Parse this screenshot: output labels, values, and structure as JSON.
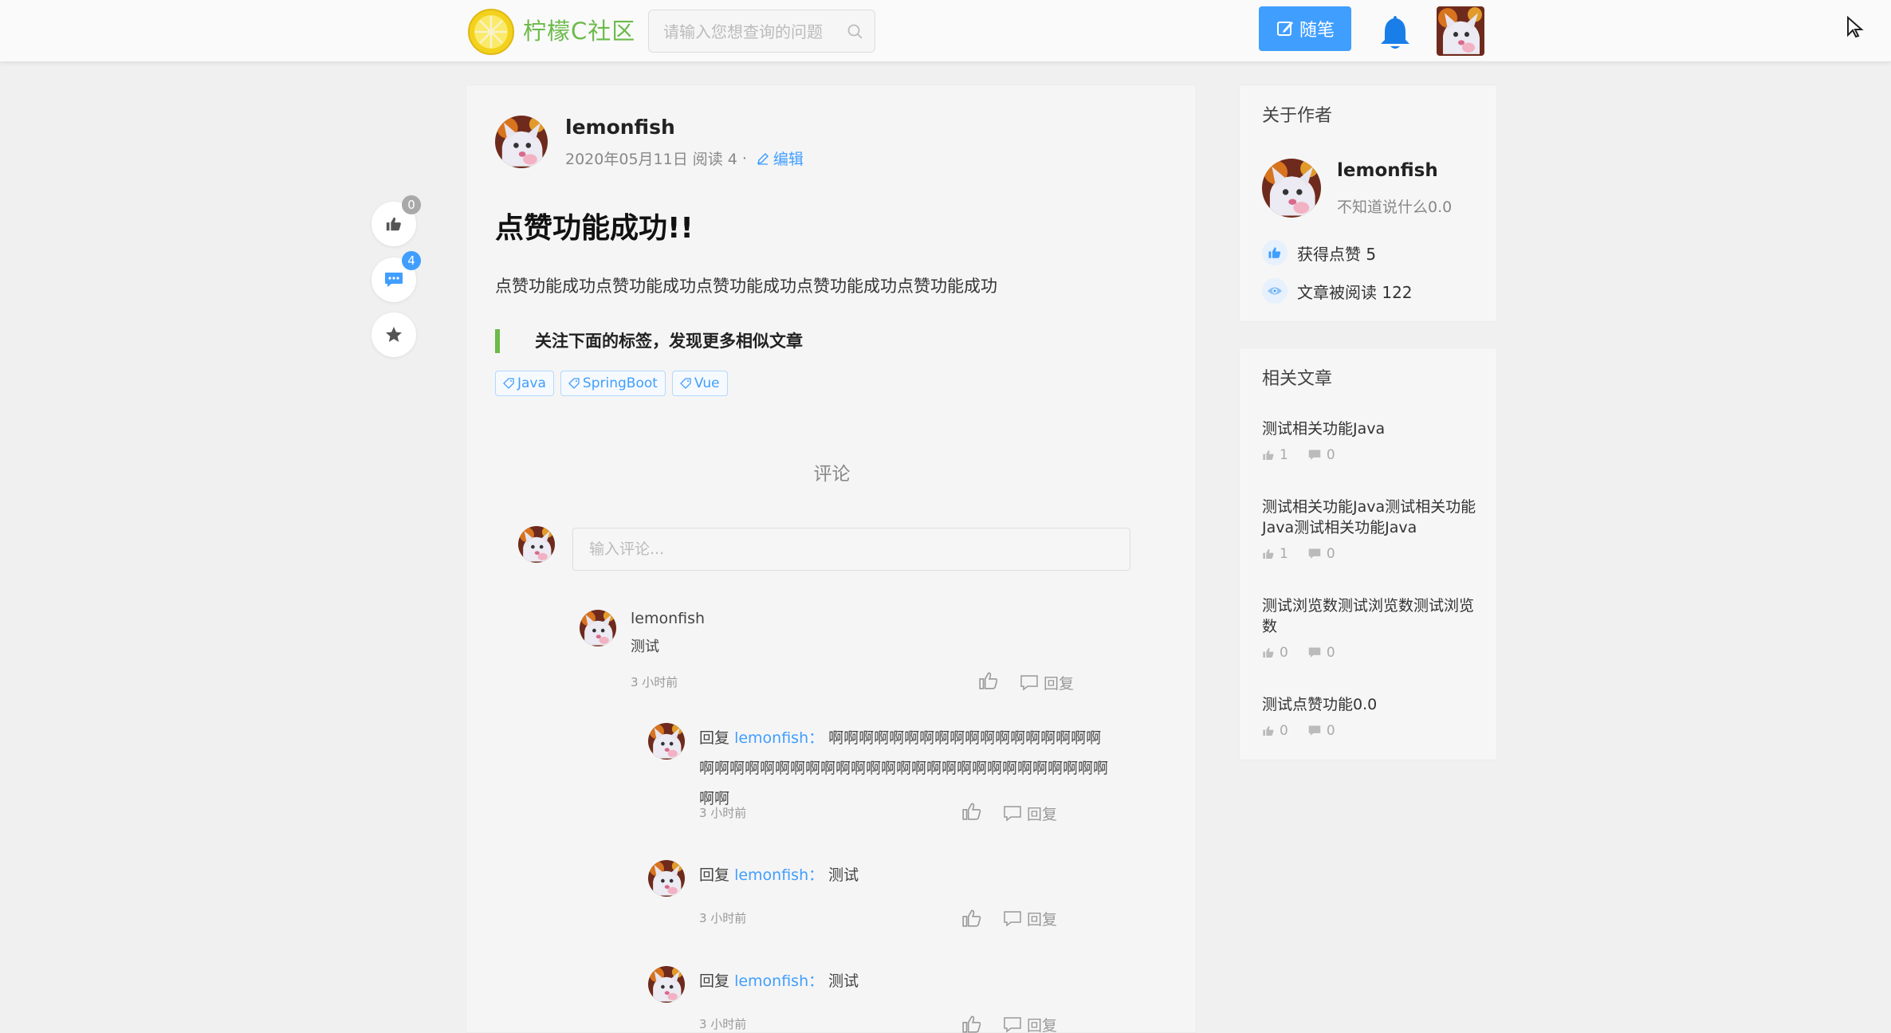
{
  "header": {
    "brand": "柠檬C社区",
    "search_placeholder": "请输入您想查询的问题",
    "write_label": "随笔"
  },
  "float_bar": {
    "like_count": "0",
    "comment_count": "4"
  },
  "article": {
    "author": "lemonfish",
    "date": "2020年05月11日",
    "reads": "阅读 4",
    "separator": "·",
    "edit_label": "编辑",
    "title": "点赞功能成功!!",
    "body": "点赞功能成功点赞功能成功点赞功能成功点赞功能成功点赞功能成功",
    "tip": "关注下面的标签，发现更多相似文章",
    "tags": [
      "Java",
      "SpringBoot",
      "Vue"
    ]
  },
  "comments": {
    "heading": "评论",
    "input_placeholder": "输入评论...",
    "reply_label": "回复",
    "top": {
      "name": "lemonfish",
      "text": "测试",
      "time": "3 小时前"
    },
    "replies": [
      {
        "prefix": "回复",
        "target": "lemonfish：",
        "text": "啊啊啊啊啊啊啊啊啊啊啊啊啊啊啊啊啊啊啊啊啊啊啊啊啊啊啊啊啊啊啊啊啊啊啊啊啊啊啊啊啊啊啊啊啊啊啊",
        "time": "3 小时前"
      },
      {
        "prefix": "回复",
        "target": "lemonfish：",
        "text": "测试",
        "time": "3 小时前"
      },
      {
        "prefix": "回复",
        "target": "lemonfish：",
        "text": "测试",
        "time": "3 小时前"
      }
    ]
  },
  "sidebar": {
    "about": {
      "title": "关于作者",
      "name": "lemonfish",
      "bio": "不知道说什么0.0",
      "likes_label": "获得点赞 5",
      "reads_label": "文章被阅读 122"
    },
    "related": {
      "title": "相关文章",
      "items": [
        {
          "title": "测试相关功能Java",
          "likes": "1",
          "comments": "0"
        },
        {
          "title": "测试相关功能Java测试相关功能Java测试相关功能Java",
          "likes": "1",
          "comments": "0"
        },
        {
          "title": "测试浏览数测试浏览数测试浏览数",
          "likes": "0",
          "comments": "0"
        },
        {
          "title": "测试点赞功能0.0",
          "likes": "0",
          "comments": "0"
        }
      ]
    }
  },
  "colors": {
    "accent": "#409eff",
    "brand_green": "#6cba4a",
    "lemon_yellow": "#f2d21c"
  }
}
